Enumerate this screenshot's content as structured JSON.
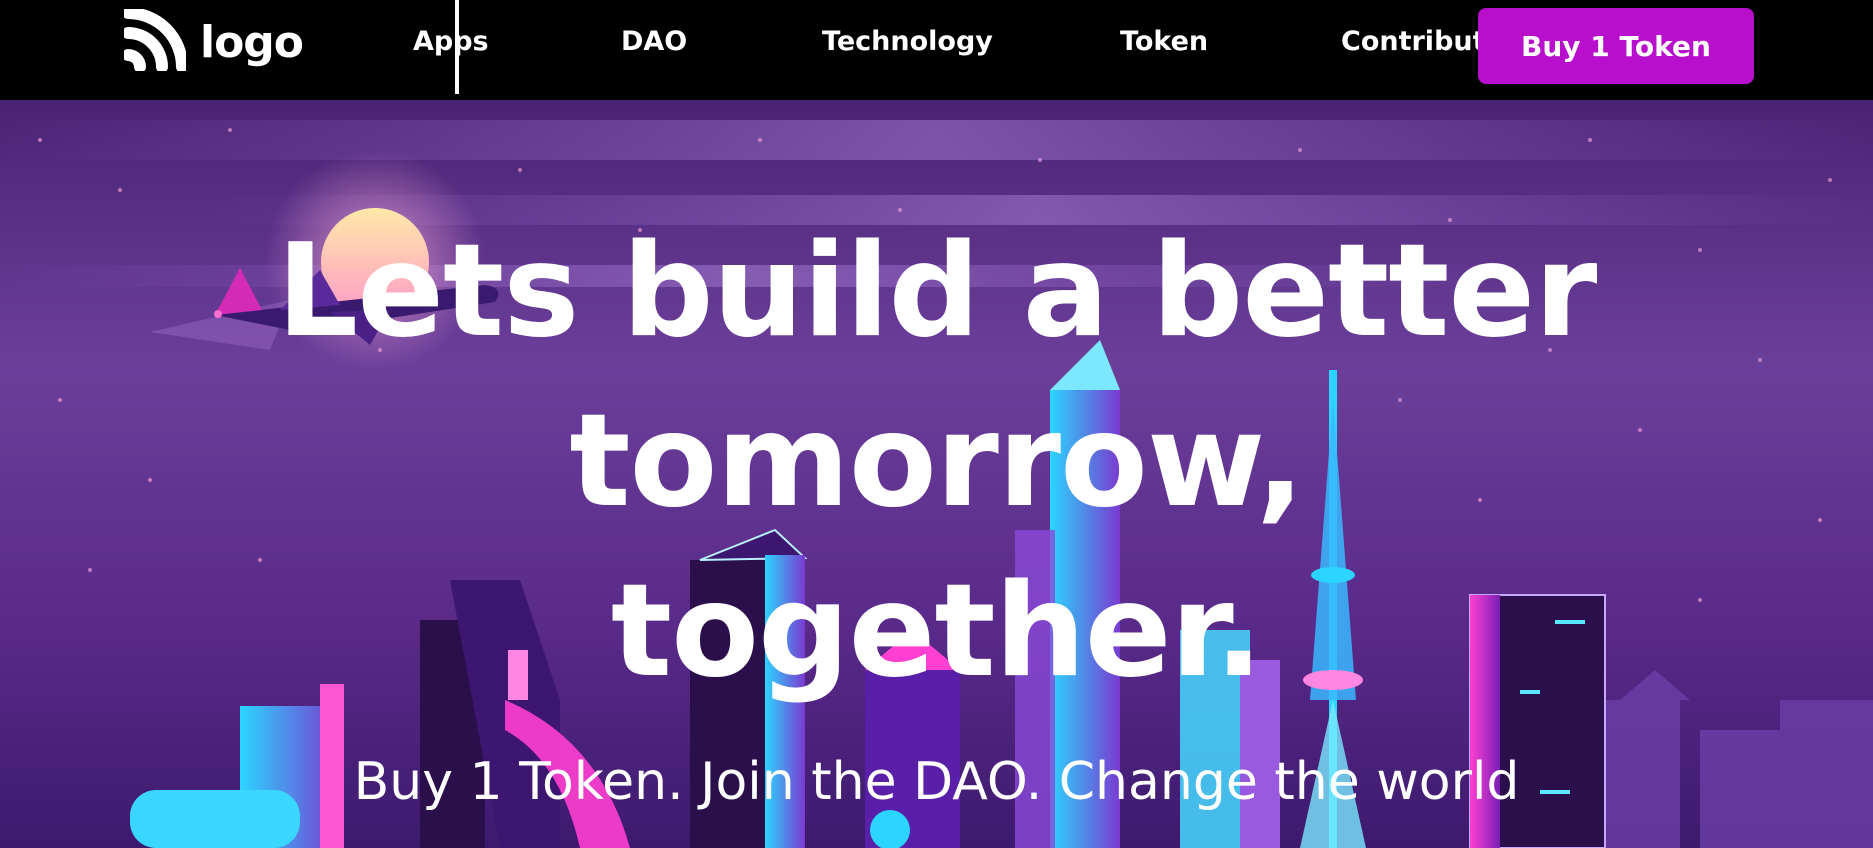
{
  "header": {
    "logo_text": "logo",
    "nav": [
      {
        "label": "Apps"
      },
      {
        "label": "DAO"
      },
      {
        "label": "Technology"
      },
      {
        "label": "Token"
      },
      {
        "label": "Contribute"
      }
    ],
    "cta_label": "Buy 1 Token"
  },
  "hero": {
    "headline_lines": [
      "Lets build a better",
      "tomorrow,",
      "together."
    ],
    "subheadline": "Buy 1 Token. Join the DAO. Change the world"
  },
  "colors": {
    "accent": "#b80fcc",
    "navbar_bg": "#000000",
    "hero_bg": "#5a2a8a",
    "text": "#ffffff"
  },
  "icons": {
    "logo_icon": "wifi-arcs-icon"
  }
}
